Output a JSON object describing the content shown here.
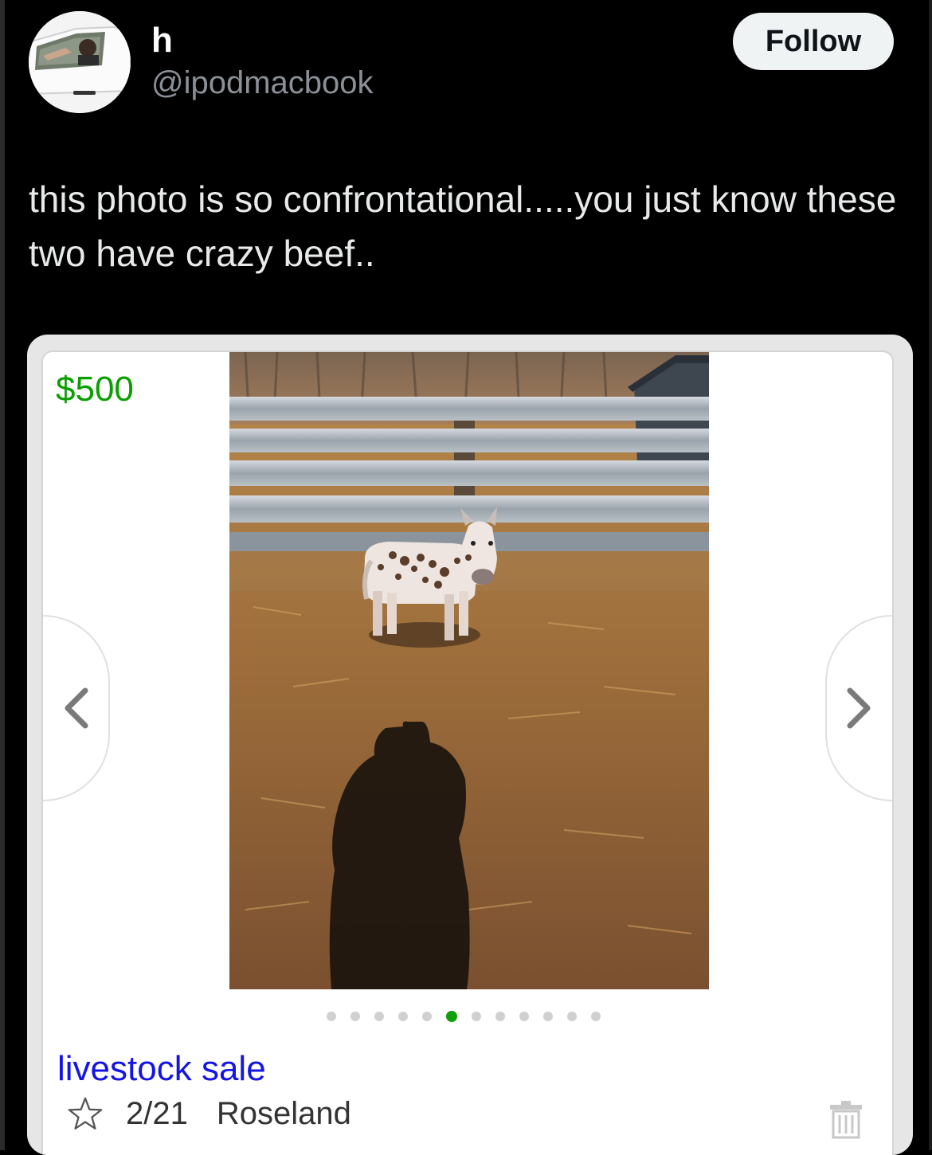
{
  "post": {
    "display_name": "h",
    "handle": "@ipodmacbook",
    "follow_label": "Follow",
    "text": "this photo is so confrontational.....you just know these two have crazy beef.."
  },
  "listing": {
    "price": "$500",
    "title": "livestock sale",
    "date": "2/21",
    "location": "Roseland",
    "image_count": 12,
    "active_image_index": 5,
    "colors": {
      "price": "#0b9e00",
      "title_link": "#1414e6",
      "active_dot": "#10a00a"
    },
    "icons": {
      "prev": "chevron-left-icon",
      "next": "chevron-right-icon",
      "favorite": "star-icon",
      "delete": "trash-icon"
    }
  }
}
